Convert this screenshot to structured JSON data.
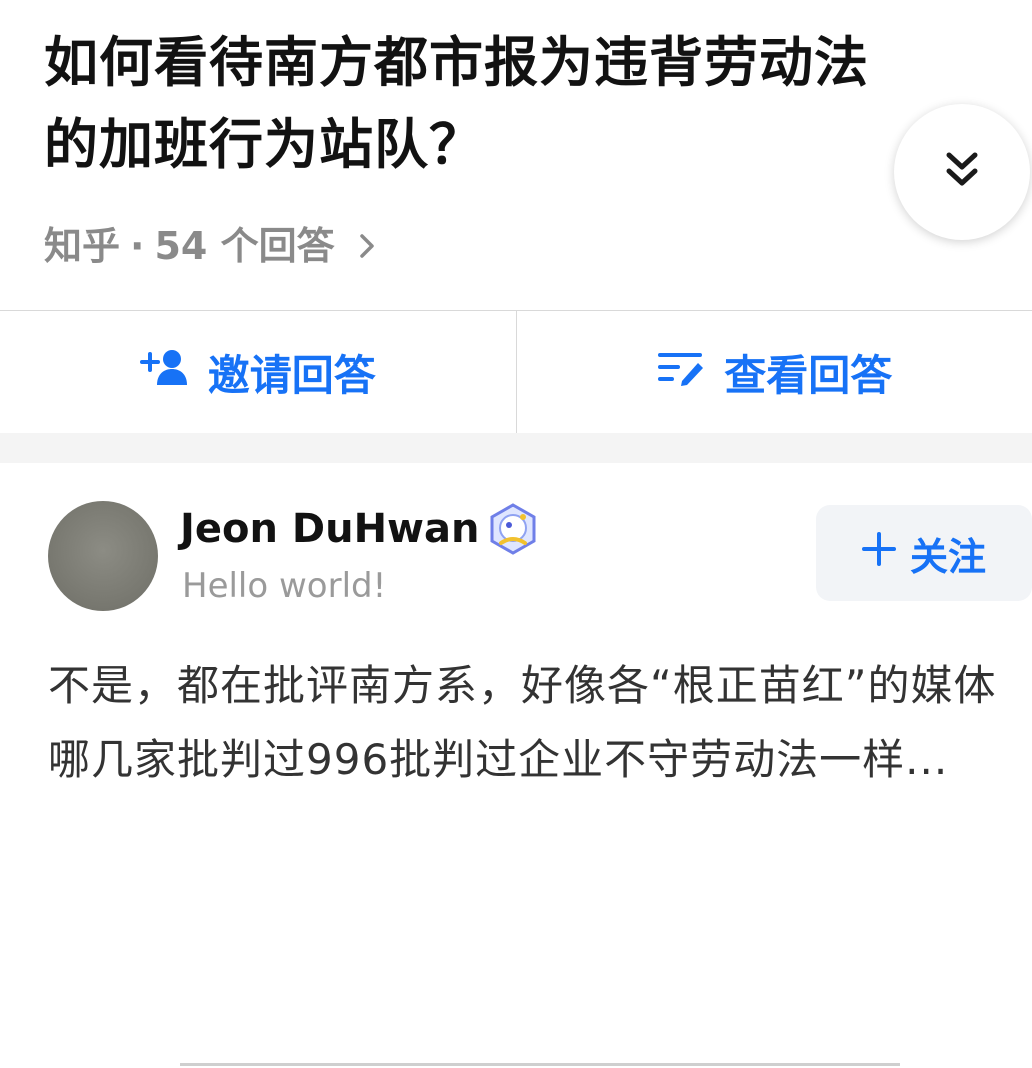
{
  "question": {
    "title": "如何看待南方都市报为违背劳动法的加班行为站队？",
    "source": "知乎",
    "separator": "·",
    "answer_count": "54 个回答",
    "expand_icon": "double-chevron-down-icon",
    "more_icon": "chevron-right-icon"
  },
  "actions": {
    "invite_label": "邀请回答",
    "invite_icon": "add-user-icon",
    "view_label": "查看回答",
    "view_icon": "write-list-icon"
  },
  "answer": {
    "author_name": "Jeon DuHwan",
    "author_bio": "Hello world!",
    "badge_icon": "creator-badge-icon",
    "follow_label": "关注",
    "follow_icon": "plus-icon",
    "excerpt": "不是，都在批评南方系，好像各“根正苗红”的媒体哪几家批判过996批判过企业不守劳动法一样..."
  },
  "colors": {
    "accent": "#1772f6",
    "title": "#121212",
    "meta": "#8a8a8a",
    "divider": "#d9d9d9",
    "band": "#f4f4f4"
  }
}
